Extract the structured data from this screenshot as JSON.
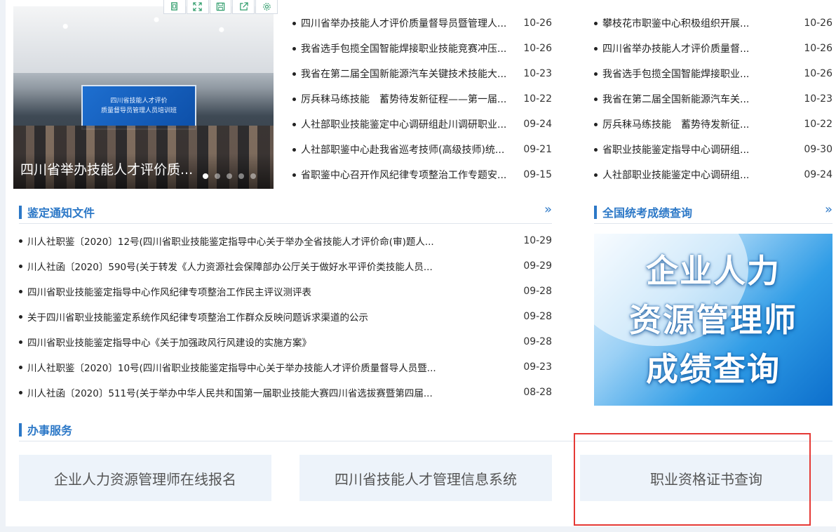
{
  "carousel": {
    "caption": "四川省举办技能人才评价质...",
    "screen_line1": "四川省技能人才评价",
    "screen_line2": "质量督导员管理人员培训班"
  },
  "toolbar": [
    "copy-icon",
    "fullscreen-icon",
    "save-icon",
    "share-icon",
    "settings-icon"
  ],
  "news_mid": [
    {
      "title": "四川省举办技能人才评价质量督导员暨管理人...",
      "date": "10-26"
    },
    {
      "title": "我省选手包揽全国智能焊接职业技能竞赛冲压...",
      "date": "10-26"
    },
    {
      "title": "我省在第二届全国新能源汽车关键技术技能大...",
      "date": "10-23"
    },
    {
      "title": "厉兵秣马练技能　蓄势待发新征程——第一届...",
      "date": "10-22"
    },
    {
      "title": "人社部职业技能鉴定中心调研组赴川调研职业...",
      "date": "09-24"
    },
    {
      "title": "人社部职鉴中心赴我省巡考技师(高级技师)统...",
      "date": "09-21"
    },
    {
      "title": "省职鉴中心召开作风纪律专项整治工作专题安...",
      "date": "09-15"
    }
  ],
  "news_right": [
    {
      "title": "攀枝花市职鉴中心积极组织开展...",
      "date": "10-26"
    },
    {
      "title": "四川省举办技能人才评价质量督...",
      "date": "10-26"
    },
    {
      "title": "我省选手包揽全国智能焊接职业...",
      "date": "10-26"
    },
    {
      "title": "我省在第二届全国新能源汽车关...",
      "date": "10-23"
    },
    {
      "title": "厉兵秣马练技能　蓄势待发新征...",
      "date": "10-22"
    },
    {
      "title": "省职业技能鉴定指导中心调研组...",
      "date": "09-30"
    },
    {
      "title": "人社部职业技能鉴定中心调研组...",
      "date": "09-24"
    }
  ],
  "sections": {
    "notice": "鉴定通知文件",
    "exam": "全国统考成绩查询",
    "service": "办事服务",
    "more_glyph": "»"
  },
  "news_notice": [
    {
      "title": "川人社职鉴〔2020〕12号(四川省职业技能鉴定指导中心关于举办全省技能人才评价命(审)题人...",
      "date": "10-29"
    },
    {
      "title": "川人社函〔2020〕590号(关于转发《人力资源社会保障部办公厅关于做好水平评价类技能人员...",
      "date": "09-29"
    },
    {
      "title": "四川省职业技能鉴定指导中心作风纪律专项整治工作民主评议测评表",
      "date": "09-28"
    },
    {
      "title": "关于四川省职业技能鉴定系统作风纪律专项整治工作群众反映问题诉求渠道的公示",
      "date": "09-28"
    },
    {
      "title": "四川省职业技能鉴定指导中心《关于加强政风行风建设的实施方案》",
      "date": "09-28"
    },
    {
      "title": "川人社职鉴〔2020〕10号(四川省职业技能鉴定指导中心关于举办技能人才评价质量督导人员暨...",
      "date": "09-23"
    },
    {
      "title": "川人社函〔2020〕511号(关于举办中华人民共和国第一届职业技能大赛四川省选拔赛暨第四届...",
      "date": "08-28"
    }
  ],
  "banner": {
    "line1": "企业人力",
    "line2": "资源管理师",
    "line3": "成绩查询"
  },
  "services": [
    "企业人力资源管理师在线报名",
    "四川省技能人才管理信息系统",
    "职业资格证书查询"
  ],
  "colors": {
    "accent": "#2c78c7",
    "highlight": "#e53935"
  }
}
